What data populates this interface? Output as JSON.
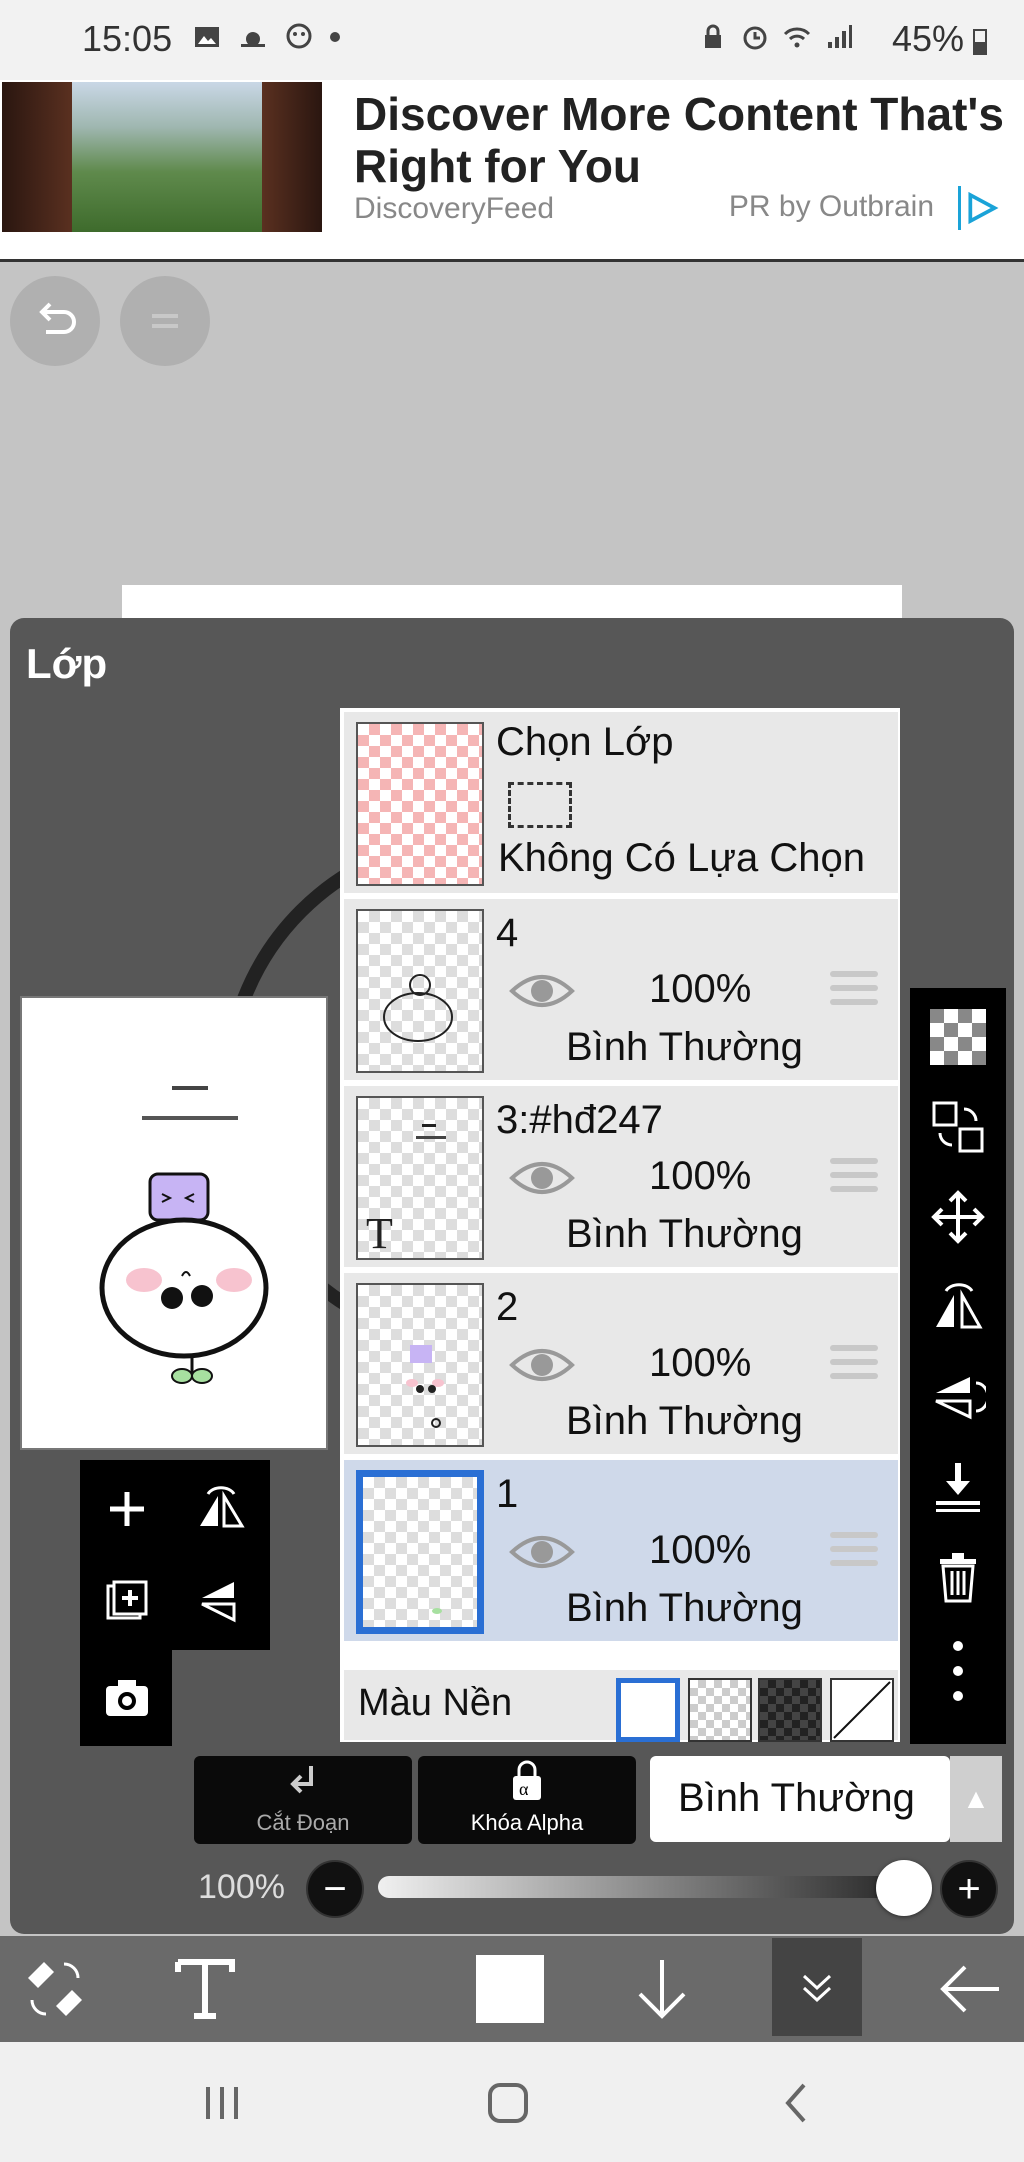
{
  "status_bar": {
    "time": "15:05",
    "battery": "45%"
  },
  "ad": {
    "title": "Discover More Content That's Right for You",
    "source": "DiscoveryFeed",
    "attribution": "PR by Outbrain"
  },
  "layers_panel": {
    "title": "Lớp",
    "selection_layer": {
      "label": "Chọn Lớp",
      "status": "Không Có Lựa Chọn"
    },
    "layers": [
      {
        "name": "4",
        "opacity": "100%",
        "blend": "Bình Thường"
      },
      {
        "name": "3:#hđ247",
        "opacity": "100%",
        "blend": "Bình Thường"
      },
      {
        "name": "2",
        "opacity": "100%",
        "blend": "Bình Thường"
      },
      {
        "name": "1",
        "opacity": "100%",
        "blend": "Bình Thường",
        "selected": true
      }
    ],
    "background": {
      "label": "Màu Nền"
    }
  },
  "layer_actions": {
    "clipping": "Cắt Đoạn",
    "alpha_lock": "Khóa Alpha",
    "blend_mode": "Bình Thường",
    "opacity_label": "100%",
    "opacity_value": 1.0
  },
  "colors": {
    "selection_blue": "#2a6fd4",
    "panel_bg": "#555555",
    "selected_row": "#cfd9ea"
  }
}
